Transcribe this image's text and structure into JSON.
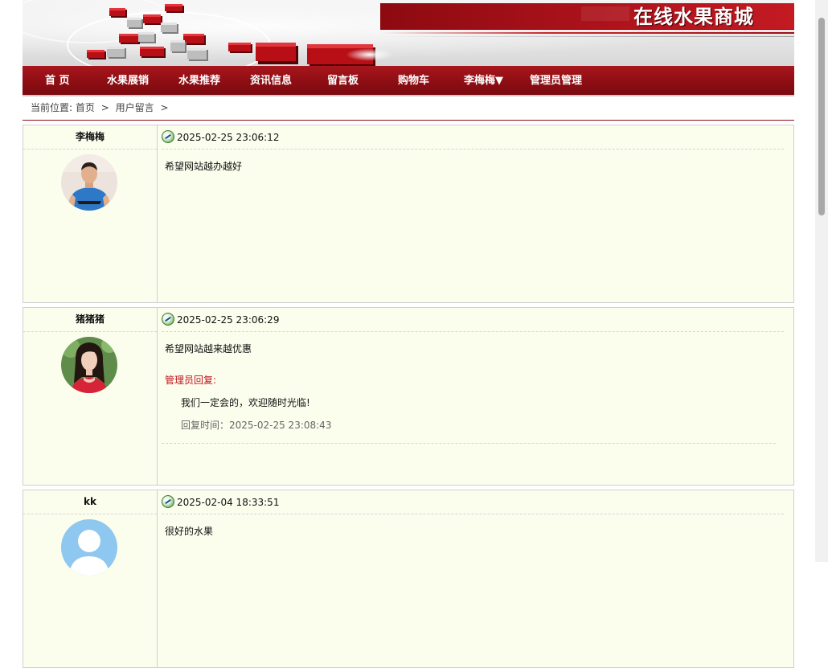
{
  "site": {
    "title": "在线水果商城"
  },
  "nav": {
    "items": [
      {
        "id": "home",
        "label": "首 页"
      },
      {
        "id": "fruit-sales",
        "label": "水果展销"
      },
      {
        "id": "fruit-recommend",
        "label": "水果推荐"
      },
      {
        "id": "news",
        "label": "资讯信息"
      },
      {
        "id": "message-board",
        "label": "留言板"
      },
      {
        "id": "cart",
        "label": "购物车"
      },
      {
        "id": "user",
        "label": "李梅梅▼"
      },
      {
        "id": "admin",
        "label": "管理员管理"
      }
    ]
  },
  "breadcrumb": {
    "prefix": "当前位置:",
    "items": [
      "首页",
      "用户留言"
    ],
    "separator": ">"
  },
  "messages": [
    {
      "user": "李梅梅",
      "time": "2025-02-25 23:06:12",
      "content": "希望网站越办越好",
      "avatar_icon": "avatar-man-blue-shirt"
    },
    {
      "user": "猪猪猪",
      "time": "2025-02-25 23:06:29",
      "content": "希望网站越来越优惠",
      "avatar_icon": "avatar-woman-red-top",
      "reply": {
        "label": "管理员回复:",
        "text": "我们一定会的，欢迎随时光临!",
        "time": "回复时间：2025-02-25 23:08:43"
      }
    },
    {
      "user": "kk",
      "time": "2025-02-04 18:33:51",
      "content": "很好的水果",
      "avatar_icon": "avatar-default-placeholder"
    }
  ],
  "colors": {
    "brand_red": "#8d0e14",
    "card_bg": "#fbfded",
    "reply_red": "#c1121a"
  }
}
